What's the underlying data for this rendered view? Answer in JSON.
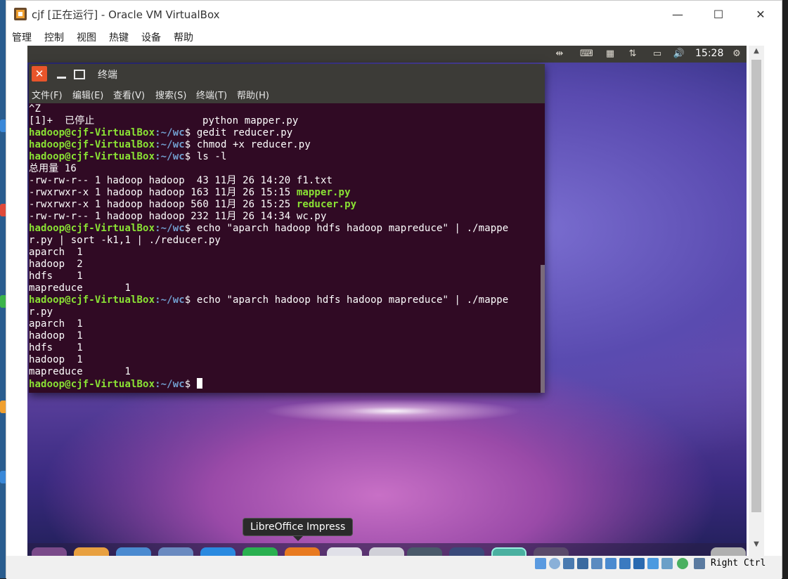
{
  "window": {
    "title": "cjf [正在运行] - Oracle VM VirtualBox",
    "minimize_glyph": "—",
    "maximize_glyph": "☐",
    "close_glyph": "✕"
  },
  "menubar": {
    "items": [
      "管理",
      "控制",
      "视图",
      "热键",
      "设备",
      "帮助"
    ]
  },
  "guest_panel": {
    "clock": "15:28",
    "tray_icons": [
      "network-icon",
      "keyboard-icon",
      "calendar-icon",
      "transfer-icon",
      "battery-icon",
      "volume-icon",
      "gear-icon"
    ]
  },
  "terminal": {
    "title": "终端",
    "close_glyph": "✕",
    "menu": [
      "文件(F)",
      "编辑(E)",
      "查看(V)",
      "搜索(S)",
      "终端(T)",
      "帮助(H)"
    ],
    "prompt_user": "hadoop@cjf-VirtualBox",
    "prompt_path": ":~/wc",
    "lines": {
      "l01": "^Z",
      "l02": "[1]+  已停止                  python mapper.py",
      "l03_cmd": "$ gedit reducer.py",
      "l04_cmd": "$ chmod +x reducer.py",
      "l05_cmd": "$ ls -l",
      "l06": "总用量 16",
      "l07": "-rw-rw-r-- 1 hadoop hadoop  43 11月 26 14:20 f1.txt",
      "l08_prefix": "-rwxrwxr-x 1 hadoop hadoop 163 11月 26 15:15 ",
      "l08_file": "mapper.py",
      "l09_prefix": "-rwxrwxr-x 1 hadoop hadoop 560 11月 26 15:25 ",
      "l09_file": "reducer.py",
      "l10": "-rw-rw-r-- 1 hadoop hadoop 232 11月 26 14:34 wc.py",
      "l11_cmd": "$ echo \"aparch hadoop hdfs hadoop mapreduce\" | ./mappe",
      "l12": "r.py | sort -k1,1 | ./reducer.py",
      "l13": "aparch  1",
      "l14": "hadoop  2",
      "l15": "hdfs    1",
      "l16": "mapreduce       1",
      "l17_cmd": "$ echo \"aparch hadoop hdfs hadoop mapreduce\" | ./mappe",
      "l18": "r.py",
      "l19": "aparch  1",
      "l20": "hadoop  1",
      "l21": "hdfs    1",
      "l22": "hadoop  1",
      "l23": "mapreduce       1",
      "l24_cmd": "$ "
    }
  },
  "tooltip": {
    "text": "LibreOffice Impress"
  },
  "statusbar": {
    "host_key": "Right Ctrl"
  },
  "colors": {
    "terminal_bg": "#300a24",
    "prompt_green": "#8ae234",
    "path_blue": "#729fcf",
    "panel": "#3c3b37"
  }
}
